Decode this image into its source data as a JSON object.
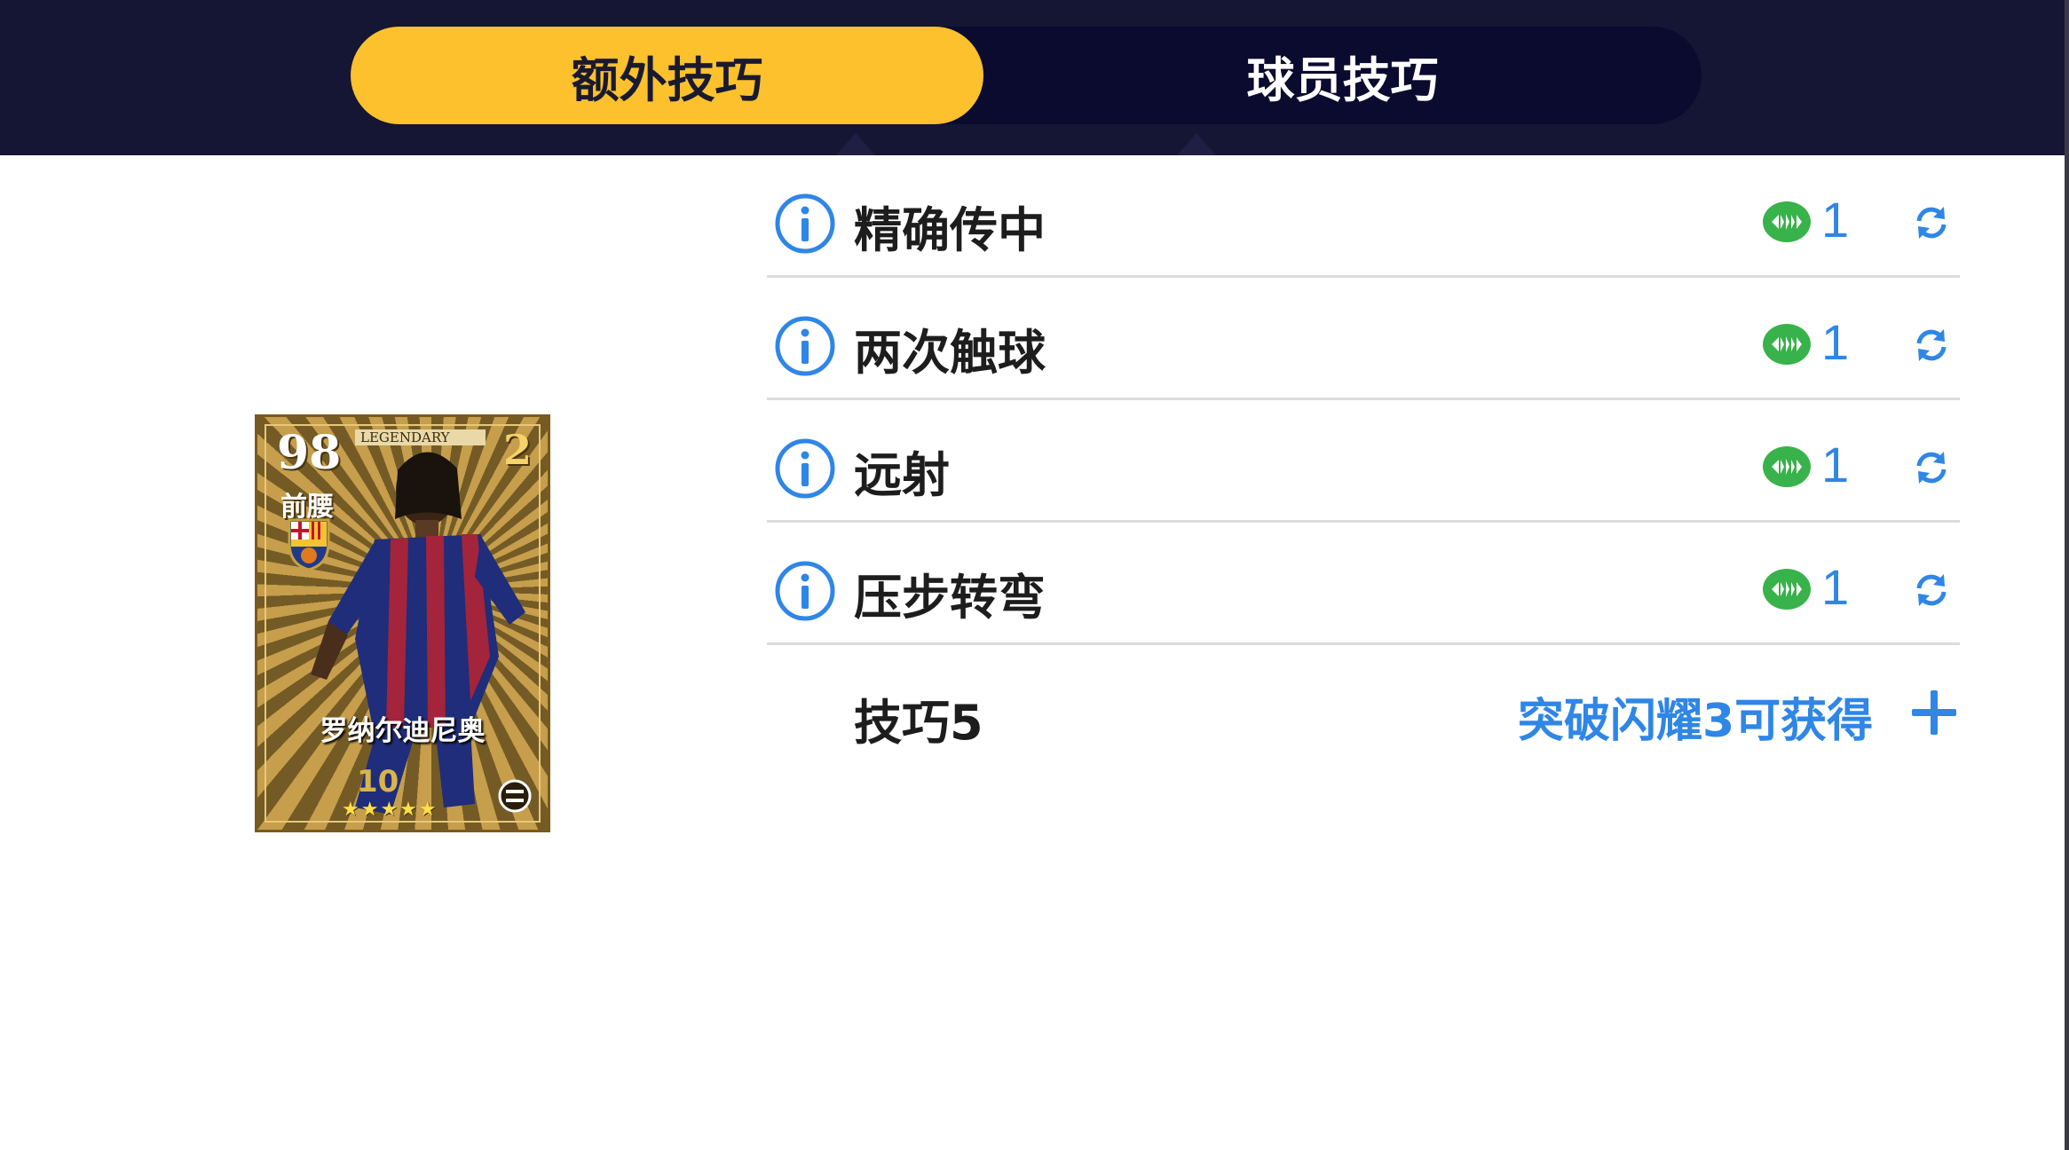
{
  "tabs": {
    "extra": "额外技巧",
    "player": "球员技巧"
  },
  "card": {
    "rating": "98",
    "position": "前腰",
    "badge": "LEGENDARY",
    "level": "2",
    "name": "罗纳尔迪尼奥",
    "stars": "★★★★★",
    "star_count": 5
  },
  "skills": [
    {
      "name": "精确传中",
      "cost": "1"
    },
    {
      "name": "两次触球",
      "cost": "1"
    },
    {
      "name": "远射",
      "cost": "1"
    },
    {
      "name": "压步转弯",
      "cost": "1"
    }
  ],
  "slot5": {
    "name": "技巧5",
    "hint": "突破闪耀3可获得"
  },
  "colors": {
    "accent_tab": "#fcc12c",
    "top_bar": "#151534",
    "link_blue": "#2f86e6",
    "coin_green": "#38b24a"
  },
  "icons": {
    "info": "info-icon",
    "coin": "skill-coin-icon",
    "refresh": "refresh-icon",
    "add": "plus-icon"
  }
}
